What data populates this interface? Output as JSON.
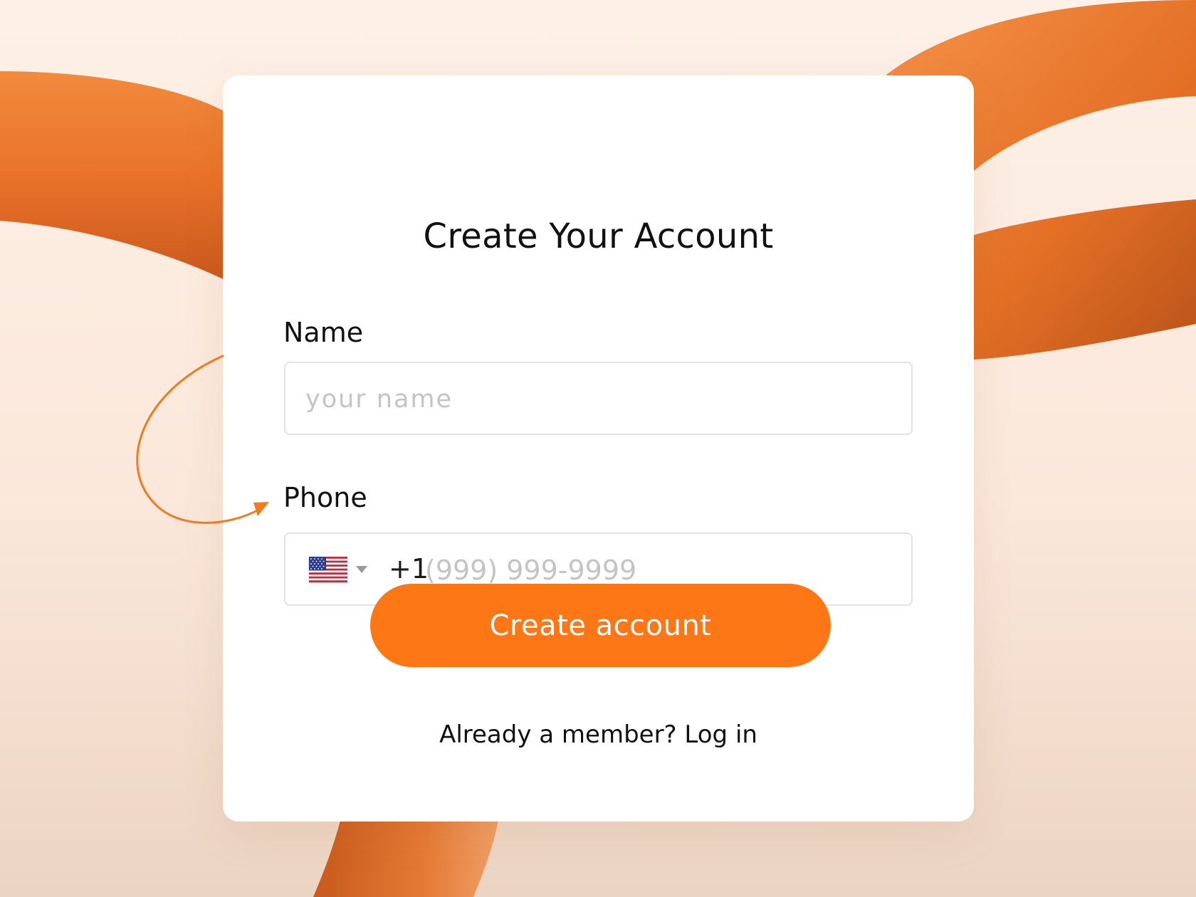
{
  "form": {
    "title": "Create Your Account",
    "name_label": "Name",
    "name_placeholder": "your name",
    "phone_label": "Phone",
    "country_flag": "us-flag-icon",
    "dial_code": "+1",
    "phone_placeholder": "(999) 999-9999",
    "submit_label": "Create account",
    "login_prompt": "Already a member?",
    "login_link": "Log in"
  },
  "colors": {
    "accent": "#fd7716",
    "background": "#fdf0e6",
    "card": "#ffffff",
    "input_border": "#e3e3e3",
    "placeholder": "#c4c4c4"
  }
}
